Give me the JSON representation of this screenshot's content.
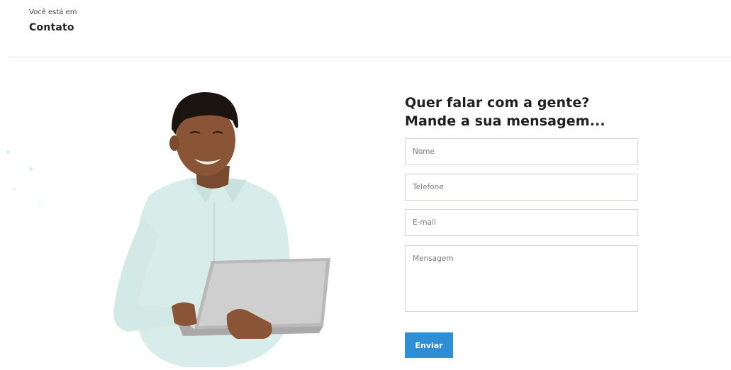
{
  "breadcrumb": {
    "prefix": "Você está em",
    "current": "Contato"
  },
  "contact_form": {
    "title": "Quer falar com a gente? Mande a sua mensagem...",
    "fields": {
      "name_placeholder": "Nome",
      "phone_placeholder": "Telefone",
      "email_placeholder": "E-mail",
      "message_placeholder": "Mensagem"
    },
    "submit_label": "Enviar"
  },
  "colors": {
    "accent": "#2e8fd6",
    "border": "#d3d6da",
    "divider": "#e6e6e6"
  },
  "illustration": {
    "icon": "person-with-laptop-illustration"
  }
}
